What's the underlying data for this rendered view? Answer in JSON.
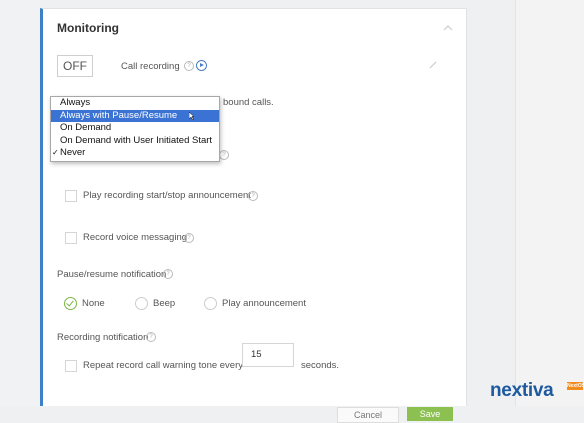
{
  "section": {
    "title": "Monitoring"
  },
  "call_recording": {
    "toggle_value": "OFF",
    "label": "Call recording",
    "description_tail": "bound calls."
  },
  "dropdown": {
    "options": [
      {
        "label": "Always",
        "selected": false,
        "checked": false
      },
      {
        "label": "Always with Pause/Resume",
        "selected": true,
        "checked": false
      },
      {
        "label": "On Demand",
        "selected": false,
        "checked": false
      },
      {
        "label": "On Demand with User Initiated Start",
        "selected": false,
        "checked": false
      },
      {
        "label": "Never",
        "selected": false,
        "checked": true
      }
    ],
    "check_mark": "✓"
  },
  "options": {
    "play_announcement": "Play recording start/stop announcement",
    "record_voice_messaging": "Record voice messaging"
  },
  "pause_resume": {
    "title": "Pause/resume notification",
    "choices": [
      "None",
      "Beep",
      "Play announcement"
    ],
    "selected": "None"
  },
  "recording_notification": {
    "title": "Recording notification",
    "repeat_label": "Repeat record call warning tone every",
    "interval_value": "15",
    "unit": "seconds."
  },
  "footer": {
    "cancel_label": "Cancel",
    "save_label": "Save"
  },
  "branding": {
    "logo_text": "nextiva",
    "badge": "NextOS"
  },
  "colors": {
    "accent": "#3d80c8",
    "selection": "#3b73d4",
    "success": "#7ab648",
    "save_button": "#8cc152"
  }
}
